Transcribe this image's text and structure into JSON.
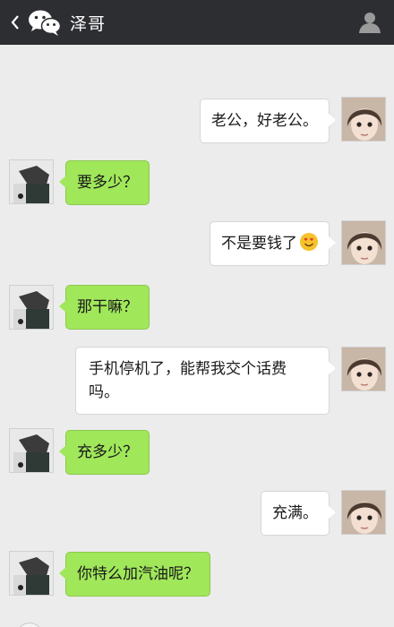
{
  "header": {
    "back_icon": "chevron-left-icon",
    "logo_icon": "wechat-logo-icon",
    "title": "泽哥",
    "contact_icon": "person-icon",
    "background": "#2d2e32"
  },
  "messages": [
    {
      "side": "out",
      "text": "老公，好老公。"
    },
    {
      "side": "in",
      "text": "要多少？"
    },
    {
      "side": "out",
      "text": "不是要钱了",
      "emoji": "smiling-face-heart-eyes-icon"
    },
    {
      "side": "in",
      "text": "那干嘛？"
    },
    {
      "side": "out",
      "text": "手机停机了，能帮我交个话费吗。"
    },
    {
      "side": "in",
      "text": "充多少？"
    },
    {
      "side": "out",
      "text": "充满。"
    },
    {
      "side": "in",
      "text": "你特么加汽油呢？"
    }
  ],
  "colors": {
    "incoming_bubble": "#a0e75a",
    "outgoing_bubble": "#ffffff",
    "chat_background": "#ececec"
  }
}
